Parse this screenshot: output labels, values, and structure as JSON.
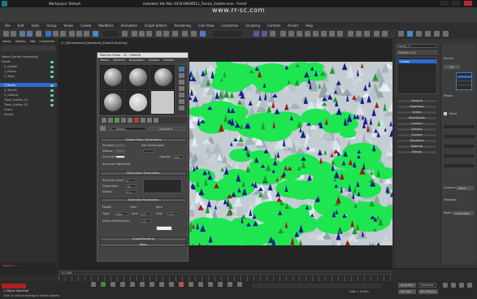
{
  "titlebar": {
    "workspace": "Workspace: Default",
    "document": "Autodesk 3ds Max 2018    ENGMD11_Terrain_Scatter.max - Forest"
  },
  "watermark": "www.rr-sc.com",
  "menubar": {
    "items": [
      "File",
      "Edit",
      "Tools",
      "Group",
      "Views",
      "Create",
      "Modifiers",
      "Animation",
      "Graph Editors",
      "Rendering",
      "Civil View",
      "Customize",
      "Scripting",
      "Content",
      "Arnold",
      "Help"
    ]
  },
  "scene_explorer": {
    "tabs": [
      "Select",
      "Display",
      "Edit",
      "Customize"
    ],
    "header": "Name (Sorted Ascending)",
    "rows": [
      "Forest",
      "0_Scatter",
      "1_Plants",
      "2_Trees",
      "3_Rocks",
      "4_Terrain",
      "5_Ground",
      "Trees_Scatter_01",
      "Trees_Scatter_02",
      "Grass",
      "Terrain"
    ],
    "footer": "Explorer 1"
  },
  "viewport": {
    "label": "[+] [Perspective] [Standard] [Default Shading]",
    "accent_colors": {
      "grass": "#1ee650",
      "rock": "#b9c3c8",
      "tree_blue": "#1c1c8c",
      "tree_red": "#a01818",
      "tree_green": "#1d9a2c"
    }
  },
  "material_editor": {
    "title": "Material Editor - 01 - Default",
    "menu": [
      "Modes",
      "Material",
      "Navigation",
      "Options",
      "Utilities"
    ],
    "mat_name": "01 - Default",
    "mat_type": "Standard",
    "shader_rollout": "Shader Basic Parameters",
    "basic_rollout": "Blinn Basic Parameters",
    "maps_rollout": "Maps",
    "ambient": "Ambient:",
    "diffuse": "Diffuse:",
    "specular": "Specular:",
    "self_illum": "Self-Illumination",
    "opacity": "Opacity:",
    "spec_highlights": "Specular Highlights",
    "spec_level": "Specular Level:",
    "glossiness": "Glossiness:",
    "soften": "Soften:",
    "spin_values": {
      "opacity": "100",
      "spec_level": "0",
      "glossiness": "10",
      "soften": "0.1"
    },
    "extra_rollout": "Extended Parameters",
    "falloff": "Falloff:",
    "filter": "Filter",
    "type_label": "Type:",
    "type_value": "Filter",
    "amt_label": "Amt:",
    "amt_value": "0.0",
    "index_label": "Index of Refraction:",
    "index_value": "1.5",
    "wire_label": "Wire",
    "wire_size_label": "Size:",
    "wire_size": "1.0",
    "supersampling": "SuperSampling"
  },
  "command_panel": {
    "object_name": "Forest_4",
    "modifier_list": "Modifier List",
    "stack": [
      "Forest"
    ],
    "rollouts": [
      "General",
      "Geometry",
      "Areas",
      "Distribution",
      "Camera",
      "Density",
      "Surface",
      "Transform",
      "Material",
      "Effects"
    ],
    "params": {
      "source_label": "Source",
      "ok_label": "OK",
      "preset_label": "Preset",
      "seed_label": "Seed",
      "camera_label": "Camera:",
      "camera_value": "None",
      "viewport_label": "Viewport",
      "mode_label": "Mode:",
      "mode_value": "Automatic"
    }
  },
  "timeline": {
    "frame": "0 / 100"
  },
  "statusbar": {
    "selected": "1 Object Selected",
    "prompt": "Click or click-and-drag to select objects",
    "grid": "Grid = 10.0m",
    "autokey": "Auto Key",
    "selected_set": "Selected",
    "setkey": "Set Key",
    "keyfilters": "Key Filters..."
  }
}
